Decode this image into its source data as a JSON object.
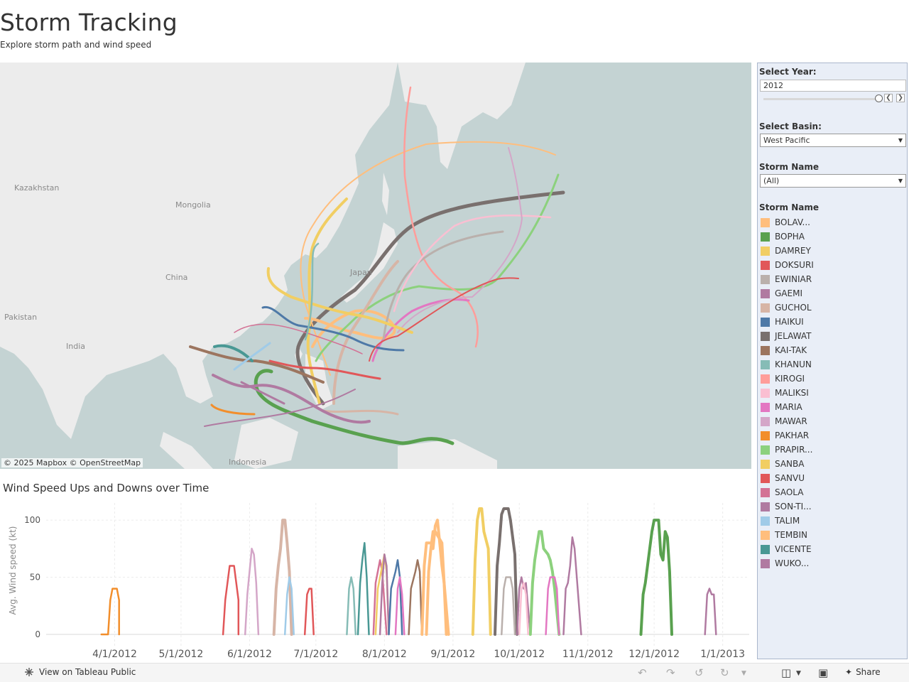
{
  "header": {
    "title": "Storm Tracking",
    "subtitle": "Explore storm path and wind speed"
  },
  "map": {
    "credit": "© 2025 Mapbox  © OpenStreetMap",
    "place_labels": [
      "Kazakhstan",
      "Mongolia",
      "China",
      "Pakistan",
      "India",
      "Japan",
      "Indonesia"
    ]
  },
  "chart_data": {
    "type": "line",
    "title": "Wind Speed Ups and Downs over Time",
    "ylabel": "Avg. Wind speed (kt)",
    "xlabel": "",
    "ylim": [
      -5,
      115
    ],
    "yticks": [
      0,
      50,
      100
    ],
    "x_tick_labels": [
      "4/1/2012",
      "5/1/2012",
      "6/1/2012",
      "7/1/2012",
      "8/1/2012",
      "9/1/2012",
      "10/1/2012",
      "11/1/2012",
      "12/1/2012",
      "1/1/2013"
    ],
    "xlim": [
      "2012-03-01",
      "2013-01-13"
    ],
    "grid": true,
    "series": [
      {
        "name": "PAKHAR",
        "color": "#f28e2b",
        "points": [
          [
            "2012-03-26",
            0
          ],
          [
            "2012-03-29",
            0
          ],
          [
            "2012-03-30",
            30
          ],
          [
            "2012-03-31",
            40
          ],
          [
            "2012-04-02",
            40
          ],
          [
            "2012-04-03",
            30
          ],
          [
            "2012-04-03",
            0
          ]
        ]
      },
      {
        "name": "SANVU",
        "color": "#e15759",
        "points": [
          [
            "2012-05-20",
            0
          ],
          [
            "2012-05-21",
            30
          ],
          [
            "2012-05-22",
            45
          ],
          [
            "2012-05-23",
            60
          ],
          [
            "2012-05-25",
            60
          ],
          [
            "2012-05-26",
            45
          ],
          [
            "2012-05-27",
            30
          ],
          [
            "2012-05-27",
            0
          ]
        ]
      },
      {
        "name": "MAWAR",
        "color": "#d4a6c8",
        "points": [
          [
            "2012-05-30",
            0
          ],
          [
            "2012-05-31",
            35
          ],
          [
            "2012-06-01",
            55
          ],
          [
            "2012-06-02",
            75
          ],
          [
            "2012-06-03",
            70
          ],
          [
            "2012-06-04",
            45
          ],
          [
            "2012-06-05",
            0
          ]
        ]
      },
      {
        "name": "GUCHOL",
        "color": "#d7b5a6",
        "points": [
          [
            "2012-06-12",
            0
          ],
          [
            "2012-06-13",
            40
          ],
          [
            "2012-06-14",
            60
          ],
          [
            "2012-06-15",
            75
          ],
          [
            "2012-06-16",
            100
          ],
          [
            "2012-06-17",
            100
          ],
          [
            "2012-06-18",
            80
          ],
          [
            "2012-06-19",
            55
          ],
          [
            "2012-06-20",
            0
          ]
        ]
      },
      {
        "name": "TALIM",
        "color": "#a0cbe8",
        "points": [
          [
            "2012-06-17",
            0
          ],
          [
            "2012-06-18",
            35
          ],
          [
            "2012-06-19",
            50
          ],
          [
            "2012-06-20",
            40
          ],
          [
            "2012-06-21",
            0
          ]
        ]
      },
      {
        "name": "DOKSURI",
        "color": "#e15759",
        "points": [
          [
            "2012-06-26",
            0
          ],
          [
            "2012-06-27",
            35
          ],
          [
            "2012-06-28",
            40
          ],
          [
            "2012-06-29",
            40
          ],
          [
            "2012-06-30",
            0
          ]
        ]
      },
      {
        "name": "KHANUN",
        "color": "#86bcb6",
        "points": [
          [
            "2012-07-15",
            0
          ],
          [
            "2012-07-16",
            40
          ],
          [
            "2012-07-17",
            50
          ],
          [
            "2012-07-18",
            40
          ],
          [
            "2012-07-19",
            0
          ]
        ]
      },
      {
        "name": "VICENTE",
        "color": "#499894",
        "points": [
          [
            "2012-07-20",
            0
          ],
          [
            "2012-07-21",
            45
          ],
          [
            "2012-07-22",
            65
          ],
          [
            "2012-07-23",
            80
          ],
          [
            "2012-07-24",
            50
          ],
          [
            "2012-07-25",
            0
          ]
        ]
      },
      {
        "name": "SAOLA",
        "color": "#d37295",
        "points": [
          [
            "2012-07-27",
            0
          ],
          [
            "2012-07-28",
            45
          ],
          [
            "2012-07-29",
            55
          ],
          [
            "2012-07-30",
            65
          ],
          [
            "2012-07-31",
            55
          ],
          [
            "2012-08-02",
            0
          ]
        ]
      },
      {
        "name": "DAMREY",
        "color": "#f1ce63",
        "points": [
          [
            "2012-07-28",
            0
          ],
          [
            "2012-07-29",
            40
          ],
          [
            "2012-07-31",
            60
          ],
          [
            "2012-08-01",
            70
          ],
          [
            "2012-08-02",
            55
          ],
          [
            "2012-08-03",
            0
          ]
        ]
      },
      {
        "name": "SON-TINH",
        "color": "#b07aa1",
        "points": [
          [
            "2012-07-30",
            0
          ],
          [
            "2012-07-31",
            45
          ],
          [
            "2012-08-01",
            70
          ],
          [
            "2012-08-02",
            60
          ],
          [
            "2012-08-03",
            0
          ]
        ]
      },
      {
        "name": "HAIKUI",
        "color": "#4e79a7",
        "points": [
          [
            "2012-08-03",
            0
          ],
          [
            "2012-08-04",
            40
          ],
          [
            "2012-08-06",
            55
          ],
          [
            "2012-08-07",
            65
          ],
          [
            "2012-08-08",
            50
          ],
          [
            "2012-08-09",
            0
          ]
        ]
      },
      {
        "name": "MARIA",
        "color": "#e377c2",
        "points": [
          [
            "2012-08-06",
            0
          ],
          [
            "2012-08-07",
            40
          ],
          [
            "2012-08-08",
            50
          ],
          [
            "2012-08-09",
            35
          ],
          [
            "2012-08-10",
            0
          ]
        ]
      },
      {
        "name": "KAI-TAK",
        "color": "#9c755f",
        "points": [
          [
            "2012-08-12",
            0
          ],
          [
            "2012-08-13",
            40
          ],
          [
            "2012-08-15",
            55
          ],
          [
            "2012-08-16",
            65
          ],
          [
            "2012-08-17",
            55
          ],
          [
            "2012-08-18",
            0
          ]
        ]
      },
      {
        "name": "TEMBIN",
        "color": "#ffbe7d",
        "points": [
          [
            "2012-08-18",
            0
          ],
          [
            "2012-08-19",
            60
          ],
          [
            "2012-08-20",
            80
          ],
          [
            "2012-08-22",
            80
          ],
          [
            "2012-08-23",
            75
          ],
          [
            "2012-08-24",
            95
          ],
          [
            "2012-08-25",
            100
          ],
          [
            "2012-08-26",
            80
          ],
          [
            "2012-08-27",
            60
          ],
          [
            "2012-08-28",
            45
          ],
          [
            "2012-08-30",
            0
          ]
        ]
      },
      {
        "name": "BOLAVEN",
        "color": "#ffbe7d",
        "points": [
          [
            "2012-08-20",
            0
          ],
          [
            "2012-08-21",
            55
          ],
          [
            "2012-08-22",
            75
          ],
          [
            "2012-08-23",
            90
          ],
          [
            "2012-08-24",
            90
          ],
          [
            "2012-08-27",
            80
          ],
          [
            "2012-08-28",
            45
          ],
          [
            "2012-08-29",
            0
          ]
        ]
      },
      {
        "name": "SANBA",
        "color": "#f1ce63",
        "points": [
          [
            "2012-09-10",
            0
          ],
          [
            "2012-09-11",
            65
          ],
          [
            "2012-09-12",
            100
          ],
          [
            "2012-09-13",
            110
          ],
          [
            "2012-09-14",
            110
          ],
          [
            "2012-09-15",
            90
          ],
          [
            "2012-09-17",
            75
          ],
          [
            "2012-09-18",
            0
          ]
        ]
      },
      {
        "name": "JELAWAT",
        "color": "#79706e",
        "points": [
          [
            "2012-09-20",
            0
          ],
          [
            "2012-09-21",
            60
          ],
          [
            "2012-09-22",
            80
          ],
          [
            "2012-09-23",
            105
          ],
          [
            "2012-09-24",
            110
          ],
          [
            "2012-09-26",
            110
          ],
          [
            "2012-09-27",
            100
          ],
          [
            "2012-09-28",
            85
          ],
          [
            "2012-09-29",
            70
          ],
          [
            "2012-09-30",
            0
          ]
        ]
      },
      {
        "name": "EWINIAR",
        "color": "#bab0ac",
        "points": [
          [
            "2012-09-23",
            0
          ],
          [
            "2012-09-24",
            40
          ],
          [
            "2012-09-25",
            50
          ],
          [
            "2012-09-27",
            50
          ],
          [
            "2012-09-28",
            40
          ],
          [
            "2012-09-29",
            0
          ]
        ]
      },
      {
        "name": "GAEMI",
        "color": "#b07aa1",
        "points": [
          [
            "2012-09-30",
            0
          ],
          [
            "2012-10-01",
            40
          ],
          [
            "2012-10-02",
            50
          ],
          [
            "2012-10-03",
            40
          ],
          [
            "2012-10-04",
            45
          ],
          [
            "2012-10-06",
            0
          ]
        ]
      },
      {
        "name": "PRAPIROON",
        "color": "#8cd17d",
        "points": [
          [
            "2012-10-06",
            0
          ],
          [
            "2012-10-07",
            45
          ],
          [
            "2012-10-08",
            65
          ],
          [
            "2012-10-10",
            90
          ],
          [
            "2012-10-11",
            90
          ],
          [
            "2012-10-12",
            75
          ],
          [
            "2012-10-14",
            70
          ],
          [
            "2012-10-15",
            65
          ],
          [
            "2012-10-16",
            55
          ],
          [
            "2012-10-17",
            40
          ],
          [
            "2012-10-19",
            0
          ]
        ]
      },
      {
        "name": "MALIKSI",
        "color": "#fabfd2",
        "points": [
          [
            "2012-10-01",
            0
          ],
          [
            "2012-10-02",
            40
          ],
          [
            "2012-10-03",
            45
          ],
          [
            "2012-10-04",
            35
          ],
          [
            "2012-10-05",
            0
          ]
        ]
      },
      {
        "name": "MARIA",
        "color": "#e377c2",
        "points": [
          [
            "2012-10-13",
            0
          ],
          [
            "2012-10-14",
            40
          ],
          [
            "2012-10-15",
            50
          ],
          [
            "2012-10-17",
            50
          ],
          [
            "2012-10-18",
            40
          ],
          [
            "2012-10-19",
            0
          ]
        ]
      },
      {
        "name": "SON-TINH",
        "color": "#b07aa1",
        "points": [
          [
            "2012-10-21",
            0
          ],
          [
            "2012-10-22",
            40
          ],
          [
            "2012-10-23",
            45
          ],
          [
            "2012-10-24",
            60
          ],
          [
            "2012-10-25",
            85
          ],
          [
            "2012-10-26",
            75
          ],
          [
            "2012-10-27",
            50
          ],
          [
            "2012-10-29",
            0
          ]
        ]
      },
      {
        "name": "BOPHA",
        "color": "#59a14f",
        "points": [
          [
            "2012-11-25",
            0
          ],
          [
            "2012-11-26",
            35
          ],
          [
            "2012-11-27",
            45
          ],
          [
            "2012-11-28",
            60
          ],
          [
            "2012-11-29",
            75
          ],
          [
            "2012-11-30",
            90
          ],
          [
            "2012-12-01",
            100
          ],
          [
            "2012-12-03",
            100
          ],
          [
            "2012-12-04",
            70
          ],
          [
            "2012-12-05",
            65
          ],
          [
            "2012-12-06",
            90
          ],
          [
            "2012-12-07",
            85
          ],
          [
            "2012-12-08",
            55
          ],
          [
            "2012-12-09",
            0
          ]
        ]
      },
      {
        "name": "WUKONG",
        "color": "#b07aa1",
        "points": [
          [
            "2012-12-24",
            0
          ],
          [
            "2012-12-25",
            35
          ],
          [
            "2012-12-26",
            40
          ],
          [
            "2012-12-27",
            35
          ],
          [
            "2012-12-28",
            35
          ],
          [
            "2012-12-29",
            0
          ]
        ]
      }
    ]
  },
  "filters": {
    "year": {
      "label": "Select Year:",
      "value": "2012"
    },
    "basin": {
      "label": "Select Basin:",
      "value": "West Pacific"
    },
    "storm": {
      "label": "Storm Name",
      "value": "(All)"
    }
  },
  "legend": {
    "title": "Storm Name",
    "items": [
      {
        "name": "BOLAV...",
        "color": "#ffbe7d"
      },
      {
        "name": "BOPHA",
        "color": "#59a14f"
      },
      {
        "name": "DAMREY",
        "color": "#f1ce63"
      },
      {
        "name": "DOKSURI",
        "color": "#e15759"
      },
      {
        "name": "EWINIAR",
        "color": "#bab0ac"
      },
      {
        "name": "GAEMI",
        "color": "#b07aa1"
      },
      {
        "name": "GUCHOL",
        "color": "#d7b5a6"
      },
      {
        "name": "HAIKUI",
        "color": "#4e79a7"
      },
      {
        "name": "JELAWAT",
        "color": "#79706e"
      },
      {
        "name": "KAI-TAK",
        "color": "#9c755f"
      },
      {
        "name": "KHANUN",
        "color": "#86bcb6"
      },
      {
        "name": "KIROGI",
        "color": "#ff9d9a"
      },
      {
        "name": "MALIKSI",
        "color": "#fabfd2"
      },
      {
        "name": "MARIA",
        "color": "#e377c2"
      },
      {
        "name": "MAWAR",
        "color": "#d4a6c8"
      },
      {
        "name": "PAKHAR",
        "color": "#f28e2b"
      },
      {
        "name": "PRAPIR...",
        "color": "#8cd17d"
      },
      {
        "name": "SANBA",
        "color": "#f1ce63"
      },
      {
        "name": "SANVU",
        "color": "#e15759"
      },
      {
        "name": "SAOLA",
        "color": "#d37295"
      },
      {
        "name": "SON-TI...",
        "color": "#b07aa1"
      },
      {
        "name": "TALIM",
        "color": "#a0cbe8"
      },
      {
        "name": "TEMBIN",
        "color": "#ffbe7d"
      },
      {
        "name": "VICENTE",
        "color": "#499894"
      },
      {
        "name": "WUKO...",
        "color": "#b07aa1"
      }
    ]
  },
  "footer": {
    "view_label": "View on Tableau Public",
    "share_label": "Share"
  }
}
